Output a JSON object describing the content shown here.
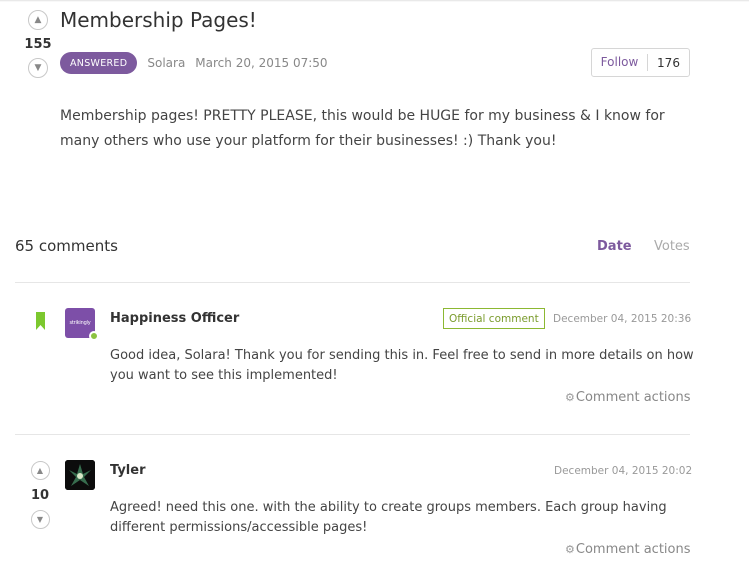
{
  "post": {
    "title": "Membership Pages!",
    "votes": "155",
    "status_badge": "ANSWERED",
    "author": "Solara",
    "date": "March 20, 2015 07:50",
    "follow_label": "Follow",
    "follow_count": "176",
    "body": "Membership pages! PRETTY PLEASE, this would be HUGE for my business & I know for many others who use your platform for their businesses! :) Thank you!"
  },
  "comments_section": {
    "count_label": "65 comments",
    "sort_options": [
      "Date",
      "Votes"
    ],
    "active_sort": "Date"
  },
  "comments": [
    {
      "author": "Happiness Officer",
      "avatar_text": "strikingly",
      "official_label": "Official comment",
      "date": "December 04, 2015 20:36",
      "body": "Good idea, Solara! Thank you for sending this in. Feel free to send in more details on how you want to see this implemented!",
      "actions_label": "Comment actions"
    },
    {
      "author": "Tyler",
      "votes": "10",
      "date": "December 04, 2015 20:02",
      "body": "Agreed! need this one. with the ability to create groups members. Each group having different permissions/accessible pages!",
      "actions_label": "Comment actions"
    }
  ],
  "icons": {
    "upvote": "chevron-up-icon",
    "downvote": "chevron-down-icon",
    "bookmark": "bookmark-icon",
    "gear": "gear-icon"
  },
  "colors": {
    "accent": "#7d5a9e",
    "official_green": "#8cb832",
    "bookmark_green": "#7cc82e"
  }
}
